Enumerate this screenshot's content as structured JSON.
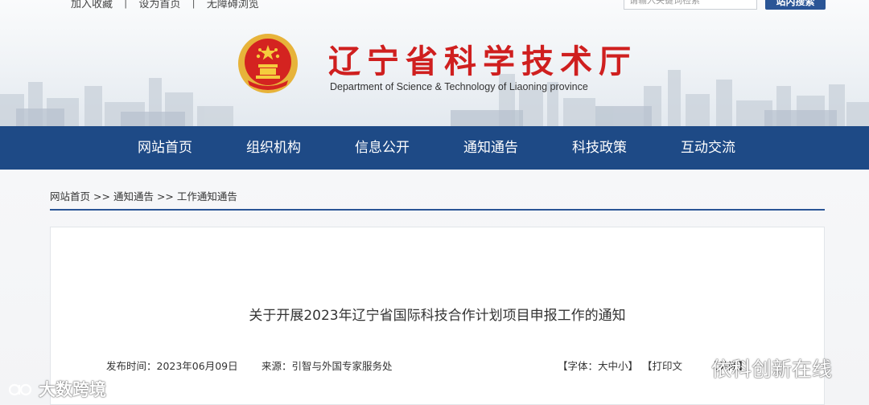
{
  "topbar": {
    "links": [
      "加入收藏",
      "设为首页",
      "无障碍浏览"
    ],
    "separator": "|",
    "search_placeholder": "请输入关键词检索",
    "search_button": "站内搜索"
  },
  "header": {
    "title": "辽宁省科学技术厅",
    "subtitle": "Department of Science & Technology of Liaoning province"
  },
  "nav": {
    "items": [
      "网站首页",
      "组织机构",
      "信息公开",
      "通知通告",
      "科技政策",
      "互动交流"
    ]
  },
  "breadcrumb": {
    "items": [
      "网站首页",
      "通知通告",
      "工作通知通告"
    ],
    "separator": ">>"
  },
  "article": {
    "title": "关于开展2023年辽宁省国际科技合作计划项目申报工作的通知",
    "publish_time": "发布时间：2023年06月09日",
    "source": "来源：引智与外国专家服务处",
    "font_size_label": "【字体：大中小】",
    "print_label": "【打印文",
    "close_label": "【关闭】"
  },
  "watermarks": {
    "left": "大数跨境",
    "right": "依科创新在线"
  },
  "colors": {
    "nav_bg": "#1e4a86",
    "title_red": "#cf1f1f",
    "accent": "#2a5596"
  },
  "icons": [
    "national-emblem-icon",
    "wechat-icon",
    "watermark-logo-icon"
  ]
}
